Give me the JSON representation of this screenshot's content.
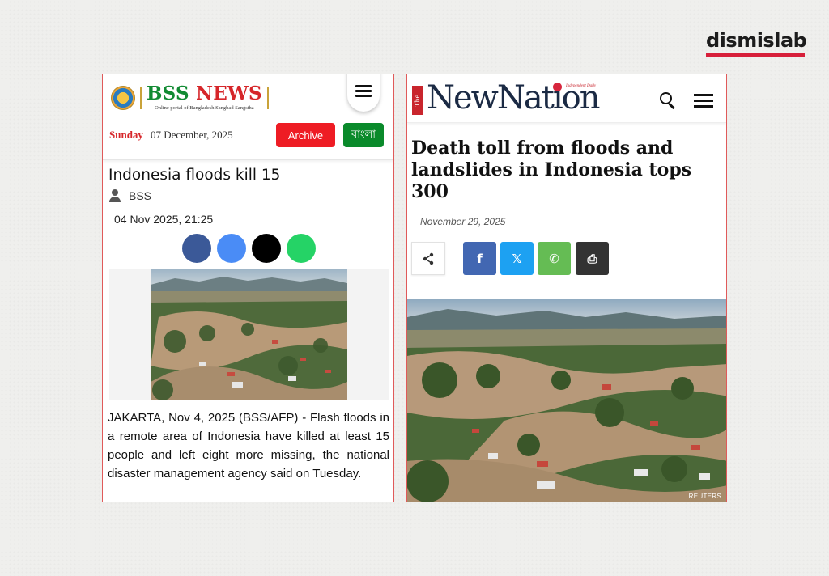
{
  "brand": {
    "name": "dismislab"
  },
  "bss": {
    "logo_title": "BSS",
    "logo_title_news": " NEWS",
    "logo_subtitle": "Online portal of Bangladesh Sangbad Sangstha",
    "day": "Sunday",
    "date": " | 07 December, 2025",
    "archive_label": "Archive",
    "bangla_label": "বাংলা",
    "headline": "Indonesia floods kill 15",
    "author": "BSS",
    "published": "04 Nov 2025, 21:25",
    "share_colors": [
      "#3b5998",
      "#4a8cf6",
      "#000000",
      "#25d366"
    ],
    "body": "JAKARTA, Nov 4, 2025 (BSS/AFP) - Flash floods in a remote area of Indonesia have killed at least 15 people and left eight more missing, the national disaster management agency said on Tuesday."
  },
  "newnation": {
    "logo_the": "The",
    "logo_title": "NewNation",
    "logo_tagline": "Independent Daily",
    "headline": "Death toll from floods and landslides in Indonesia tops 300",
    "date": "November 29, 2025",
    "share_buttons": [
      {
        "name": "facebook",
        "glyph": "f",
        "color": "#4267b2"
      },
      {
        "name": "twitter-x",
        "glyph": "𝕏",
        "color": "#1da1f2"
      },
      {
        "name": "whatsapp",
        "glyph": "✆",
        "color": "#65bc54"
      },
      {
        "name": "print",
        "glyph": "⎙",
        "color": "#333333"
      }
    ],
    "photo_credit": "REUTERS"
  }
}
